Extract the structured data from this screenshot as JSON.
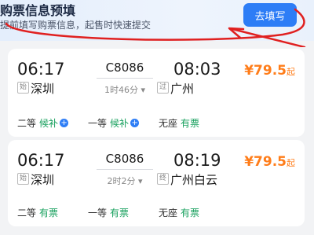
{
  "banner": {
    "title": "购票信息预填",
    "subtitle": "提前填写购票信息，起售时快速提交",
    "button_label": "去填写"
  },
  "trains": [
    {
      "dep_time": "06:17",
      "train_no": "C8086",
      "duration": "1时46分 ▾",
      "arr_time": "08:03",
      "dep_tag": "始",
      "dep_station": "深圳",
      "arr_tag": "过",
      "arr_station": "广州",
      "price": "¥79.5",
      "price_suffix": "起",
      "seats": [
        {
          "class": "二等",
          "status": "候补"
        },
        {
          "class": "一等",
          "status": "候补"
        },
        {
          "class": "无座",
          "status": "有票"
        }
      ]
    },
    {
      "dep_time": "06:17",
      "train_no": "C8086",
      "duration": "2时2分 ▾",
      "arr_time": "08:19",
      "dep_tag": "始",
      "dep_station": "深圳",
      "arr_tag": "终",
      "arr_station": "广州白云",
      "price": "¥79.5",
      "price_suffix": "起",
      "seats": [
        {
          "class": "二等",
          "status": "有票"
        },
        {
          "class": "一等",
          "status": "有票"
        },
        {
          "class": "无座",
          "status": "有票"
        }
      ]
    }
  ],
  "colors": {
    "accent": "#2d7df6",
    "price": "#ff7d1a",
    "available": "#17a05d",
    "annotation": "#e02020"
  },
  "icons": {
    "plus": "plus-circle-icon"
  }
}
